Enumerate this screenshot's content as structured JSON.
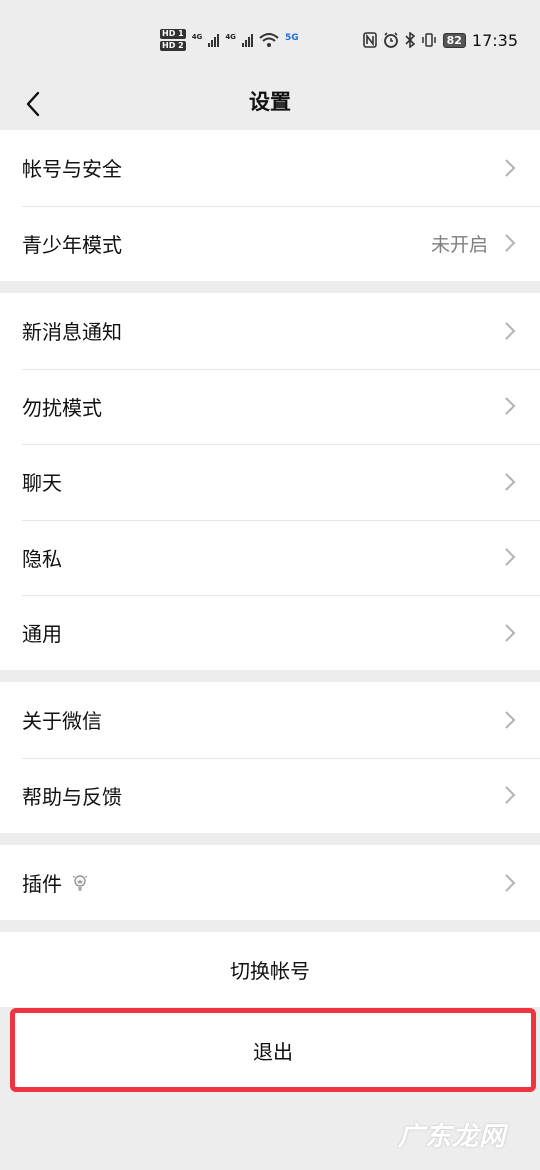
{
  "status_bar": {
    "hd1": "HD 1",
    "hd2": "HD 2",
    "net1": "4G",
    "net2": "4G",
    "net3": "5G",
    "battery": "82",
    "time": "17:35"
  },
  "nav": {
    "title": "设置"
  },
  "groups": [
    [
      {
        "label": "帐号与安全",
        "status": ""
      },
      {
        "label": "青少年模式",
        "status": "未开启"
      }
    ],
    [
      {
        "label": "新消息通知",
        "status": ""
      },
      {
        "label": "勿扰模式",
        "status": ""
      },
      {
        "label": "聊天",
        "status": ""
      },
      {
        "label": "隐私",
        "status": ""
      },
      {
        "label": "通用",
        "status": ""
      }
    ],
    [
      {
        "label": "关于微信",
        "status": ""
      },
      {
        "label": "帮助与反馈",
        "status": ""
      }
    ],
    [
      {
        "label": "插件",
        "status": ""
      }
    ]
  ],
  "actions": {
    "switch_account": "切换帐号",
    "logout": "退出"
  },
  "watermark": "广东龙网",
  "colors": {
    "highlight_border": "#ef3340",
    "background": "#ededed"
  }
}
